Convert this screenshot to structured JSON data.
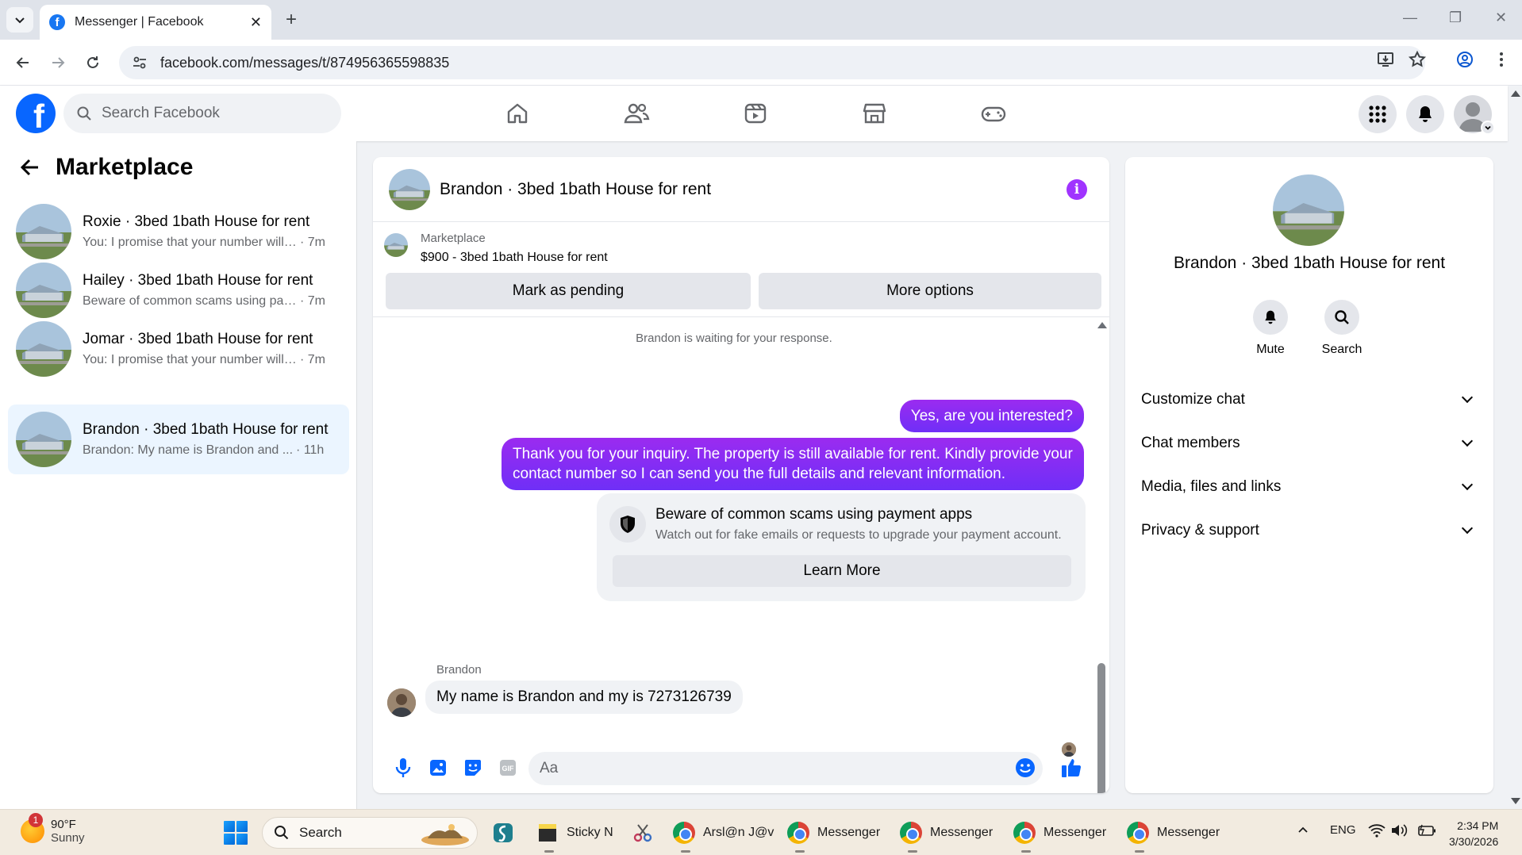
{
  "browser": {
    "tab_title": "Messenger | Facebook",
    "url": "facebook.com/messages/t/874956365598835"
  },
  "fb_header": {
    "search_placeholder": "Search Facebook",
    "logo_letter": "f"
  },
  "left_panel": {
    "title": "Marketplace",
    "conversations": [
      {
        "name": "Roxie · 3bed 1bath House for rent",
        "preview": "You: I promise that your number will ...",
        "time": "· 7m"
      },
      {
        "name": "Hailey · 3bed 1bath House for rent",
        "preview": "Beware of common scams using pay...",
        "time": "· 7m"
      },
      {
        "name": "Jomar · 3bed 1bath House for rent",
        "preview": "You: I promise that your number will ...",
        "time": "· 7m"
      },
      {
        "name": "Brandon · 3bed 1bath House for rent",
        "preview": "Brandon: My name is Brandon and ...",
        "time": "· 11h"
      }
    ]
  },
  "chat": {
    "title": "Brandon · 3bed 1bath House for rent",
    "listing_label": "Marketplace",
    "listing_price": "$900 - 3bed 1bath House for rent",
    "mark_pending": "Mark as pending",
    "more_options": "More options",
    "waiting_note": "Brandon is waiting for your response.",
    "messages": [
      {
        "from": "me",
        "text": "Yes, are you interested?"
      },
      {
        "from": "me",
        "text": "Thank you for your inquiry. The property is still available for rent. Kindly provide your contact number so I can send you the full details and relevant information."
      },
      {
        "from": "Brandon",
        "text": "My name is Brandon and my is 7273126739"
      }
    ],
    "scam_card": {
      "heading": "Beware of common scams using payment apps",
      "subtext": "Watch out for fake emails or requests to upgrade your payment account.",
      "button": "Learn More"
    },
    "sender_label": "Brandon",
    "input_placeholder": "Aa"
  },
  "right_panel": {
    "name": "Brandon · 3bed 1bath House for rent",
    "actions": [
      "Mute",
      "Search"
    ],
    "sections": [
      "Customize chat",
      "Chat members",
      "Media, files and links",
      "Privacy & support"
    ]
  },
  "taskbar": {
    "weather_temp": "90°F",
    "weather_desc": "Sunny",
    "weather_badge": "1",
    "search_label": "Search",
    "apps": [
      {
        "label": "Sticky N"
      },
      {
        "label": "Arsl@n J@v"
      },
      {
        "label": "Messenger"
      },
      {
        "label": "Messenger"
      },
      {
        "label": "Messenger"
      },
      {
        "label": "Messenger"
      }
    ],
    "language": "ENG",
    "time": "2:34 PM",
    "date": "3/30/2026"
  },
  "colors": {
    "accent": "#0866ff",
    "message_bubble": "#7b2ff7",
    "info_icon": "#a033ff",
    "active_conversation": "#ebf5ff"
  }
}
